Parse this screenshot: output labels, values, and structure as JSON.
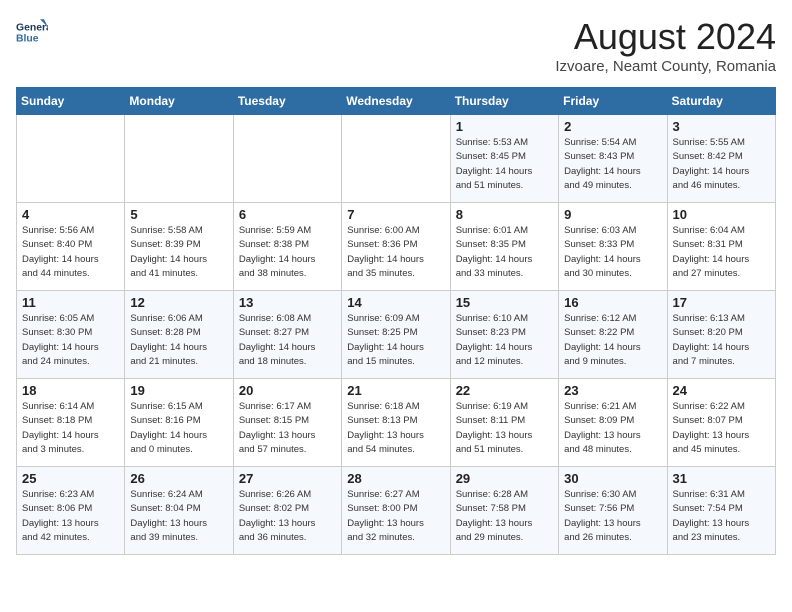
{
  "header": {
    "logo_line1": "General",
    "logo_line2": "Blue",
    "month_year": "August 2024",
    "location": "Izvoare, Neamt County, Romania"
  },
  "weekdays": [
    "Sunday",
    "Monday",
    "Tuesday",
    "Wednesday",
    "Thursday",
    "Friday",
    "Saturday"
  ],
  "weeks": [
    [
      {
        "day": "",
        "info": ""
      },
      {
        "day": "",
        "info": ""
      },
      {
        "day": "",
        "info": ""
      },
      {
        "day": "",
        "info": ""
      },
      {
        "day": "1",
        "info": "Sunrise: 5:53 AM\nSunset: 8:45 PM\nDaylight: 14 hours\nand 51 minutes."
      },
      {
        "day": "2",
        "info": "Sunrise: 5:54 AM\nSunset: 8:43 PM\nDaylight: 14 hours\nand 49 minutes."
      },
      {
        "day": "3",
        "info": "Sunrise: 5:55 AM\nSunset: 8:42 PM\nDaylight: 14 hours\nand 46 minutes."
      }
    ],
    [
      {
        "day": "4",
        "info": "Sunrise: 5:56 AM\nSunset: 8:40 PM\nDaylight: 14 hours\nand 44 minutes."
      },
      {
        "day": "5",
        "info": "Sunrise: 5:58 AM\nSunset: 8:39 PM\nDaylight: 14 hours\nand 41 minutes."
      },
      {
        "day": "6",
        "info": "Sunrise: 5:59 AM\nSunset: 8:38 PM\nDaylight: 14 hours\nand 38 minutes."
      },
      {
        "day": "7",
        "info": "Sunrise: 6:00 AM\nSunset: 8:36 PM\nDaylight: 14 hours\nand 35 minutes."
      },
      {
        "day": "8",
        "info": "Sunrise: 6:01 AM\nSunset: 8:35 PM\nDaylight: 14 hours\nand 33 minutes."
      },
      {
        "day": "9",
        "info": "Sunrise: 6:03 AM\nSunset: 8:33 PM\nDaylight: 14 hours\nand 30 minutes."
      },
      {
        "day": "10",
        "info": "Sunrise: 6:04 AM\nSunset: 8:31 PM\nDaylight: 14 hours\nand 27 minutes."
      }
    ],
    [
      {
        "day": "11",
        "info": "Sunrise: 6:05 AM\nSunset: 8:30 PM\nDaylight: 14 hours\nand 24 minutes."
      },
      {
        "day": "12",
        "info": "Sunrise: 6:06 AM\nSunset: 8:28 PM\nDaylight: 14 hours\nand 21 minutes."
      },
      {
        "day": "13",
        "info": "Sunrise: 6:08 AM\nSunset: 8:27 PM\nDaylight: 14 hours\nand 18 minutes."
      },
      {
        "day": "14",
        "info": "Sunrise: 6:09 AM\nSunset: 8:25 PM\nDaylight: 14 hours\nand 15 minutes."
      },
      {
        "day": "15",
        "info": "Sunrise: 6:10 AM\nSunset: 8:23 PM\nDaylight: 14 hours\nand 12 minutes."
      },
      {
        "day": "16",
        "info": "Sunrise: 6:12 AM\nSunset: 8:22 PM\nDaylight: 14 hours\nand 9 minutes."
      },
      {
        "day": "17",
        "info": "Sunrise: 6:13 AM\nSunset: 8:20 PM\nDaylight: 14 hours\nand 7 minutes."
      }
    ],
    [
      {
        "day": "18",
        "info": "Sunrise: 6:14 AM\nSunset: 8:18 PM\nDaylight: 14 hours\nand 3 minutes."
      },
      {
        "day": "19",
        "info": "Sunrise: 6:15 AM\nSunset: 8:16 PM\nDaylight: 14 hours\nand 0 minutes."
      },
      {
        "day": "20",
        "info": "Sunrise: 6:17 AM\nSunset: 8:15 PM\nDaylight: 13 hours\nand 57 minutes."
      },
      {
        "day": "21",
        "info": "Sunrise: 6:18 AM\nSunset: 8:13 PM\nDaylight: 13 hours\nand 54 minutes."
      },
      {
        "day": "22",
        "info": "Sunrise: 6:19 AM\nSunset: 8:11 PM\nDaylight: 13 hours\nand 51 minutes."
      },
      {
        "day": "23",
        "info": "Sunrise: 6:21 AM\nSunset: 8:09 PM\nDaylight: 13 hours\nand 48 minutes."
      },
      {
        "day": "24",
        "info": "Sunrise: 6:22 AM\nSunset: 8:07 PM\nDaylight: 13 hours\nand 45 minutes."
      }
    ],
    [
      {
        "day": "25",
        "info": "Sunrise: 6:23 AM\nSunset: 8:06 PM\nDaylight: 13 hours\nand 42 minutes."
      },
      {
        "day": "26",
        "info": "Sunrise: 6:24 AM\nSunset: 8:04 PM\nDaylight: 13 hours\nand 39 minutes."
      },
      {
        "day": "27",
        "info": "Sunrise: 6:26 AM\nSunset: 8:02 PM\nDaylight: 13 hours\nand 36 minutes."
      },
      {
        "day": "28",
        "info": "Sunrise: 6:27 AM\nSunset: 8:00 PM\nDaylight: 13 hours\nand 32 minutes."
      },
      {
        "day": "29",
        "info": "Sunrise: 6:28 AM\nSunset: 7:58 PM\nDaylight: 13 hours\nand 29 minutes."
      },
      {
        "day": "30",
        "info": "Sunrise: 6:30 AM\nSunset: 7:56 PM\nDaylight: 13 hours\nand 26 minutes."
      },
      {
        "day": "31",
        "info": "Sunrise: 6:31 AM\nSunset: 7:54 PM\nDaylight: 13 hours\nand 23 minutes."
      }
    ]
  ]
}
